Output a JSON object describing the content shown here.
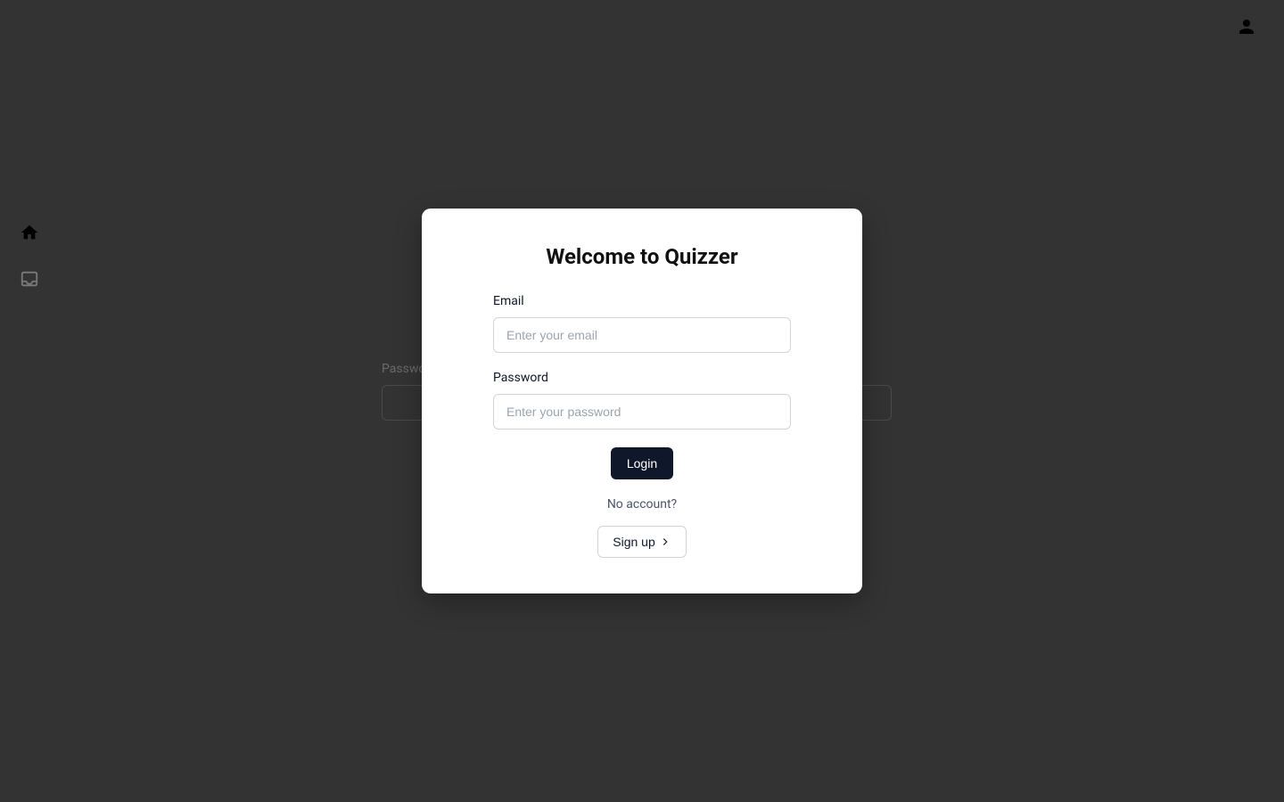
{
  "header": {
    "person_icon": "person-icon"
  },
  "sidebar": {
    "home_icon": "home-icon",
    "inbox_icon": "inbox-icon"
  },
  "background": {
    "password_label": "Password"
  },
  "modal": {
    "title": "Welcome to Quizzer",
    "email": {
      "label": "Email",
      "placeholder": "Enter your email"
    },
    "password": {
      "label": "Password",
      "placeholder": "Enter your password"
    },
    "login_button": "Login",
    "no_account_text": "No account?",
    "signup_button": "Sign up"
  }
}
